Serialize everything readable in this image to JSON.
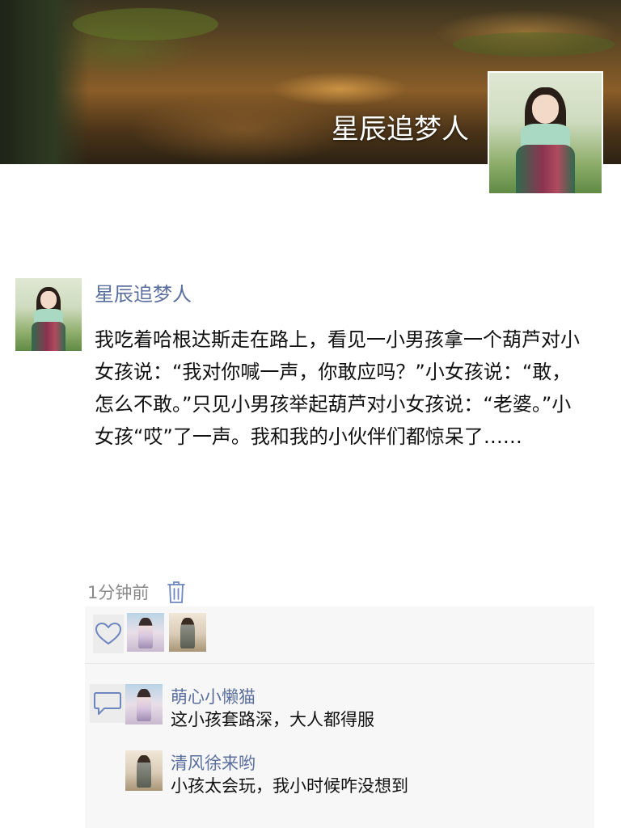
{
  "profile": {
    "cover_name": "星辰追梦人"
  },
  "post": {
    "author": "星辰追梦人",
    "content": "我吃着哈根达斯走在路上，看见一小男孩拿一个葫芦对小女孩说：“我对你喊一声，你敢应吗？”小女孩说：“敢，怎么不敢。”只见小男孩举起葫芦对小女孩说：“老婆。”小女孩“哎”了一声。我和我的小伙伴们都惊呆了……",
    "time": "1分钟前"
  },
  "likes": {
    "icon": "heart-outline-icon"
  },
  "comments": [
    {
      "author": "萌心小懒猫",
      "text": "这小孩套路深，大人都得服"
    },
    {
      "author": "清风徐来哟",
      "text": "小孩太会玩，我小时候咋没想到"
    }
  ],
  "colors": {
    "name_link": "#5a6f9e",
    "body_text": "#111111",
    "meta_text": "#8a8a8a",
    "panel_bg": "#f7f7f7"
  }
}
